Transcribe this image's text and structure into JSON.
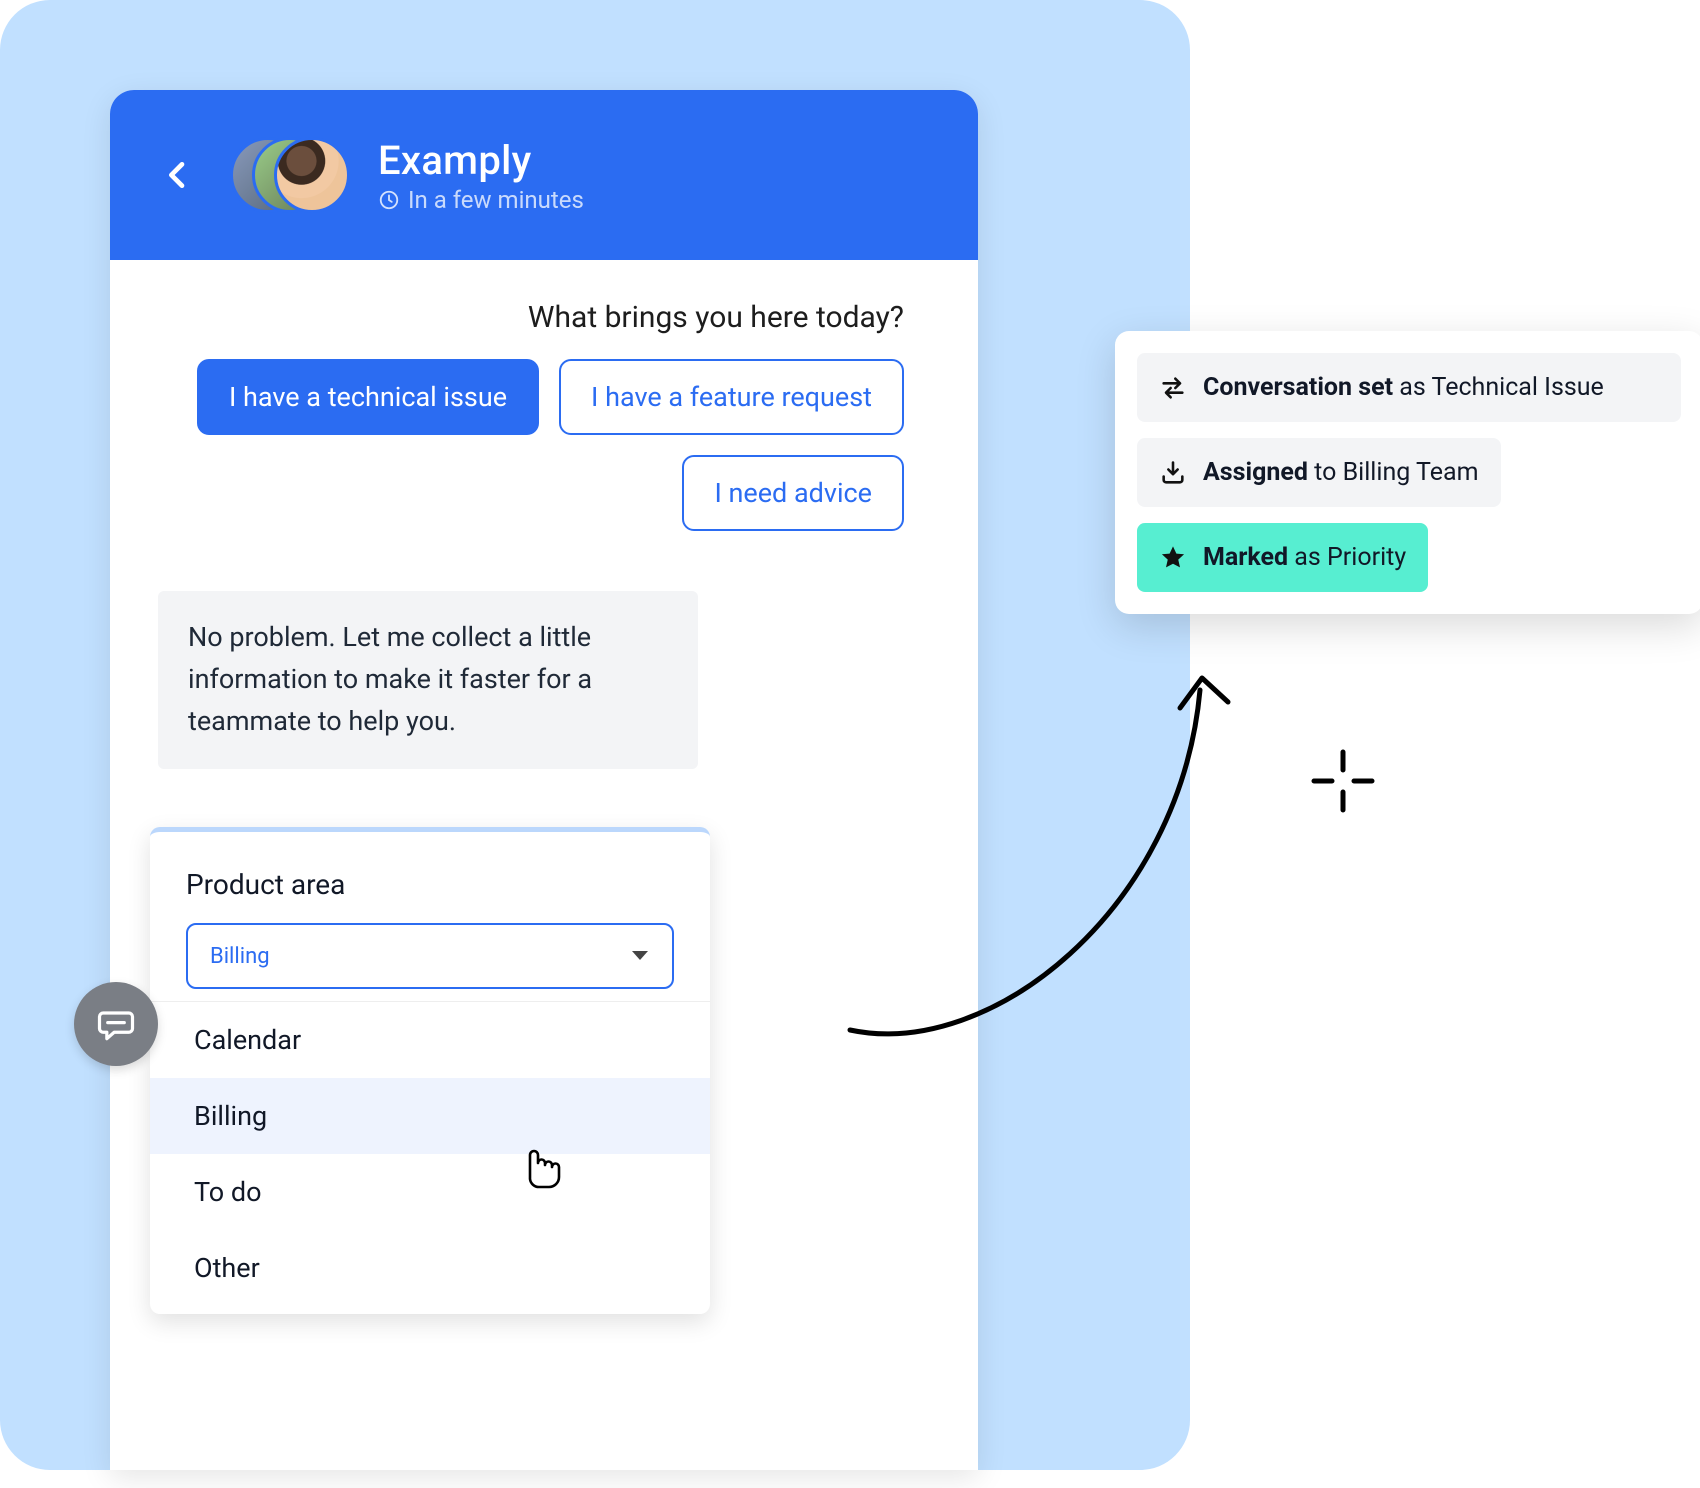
{
  "company": "Examply",
  "status_text": "In a few minutes",
  "bot_question": "What brings you here today?",
  "options": {
    "selected": "I have a technical issue",
    "other": [
      "I have a feature request",
      "I need advice"
    ]
  },
  "bot_followup": "No problem. Let me collect a little information to make it faster for a teammate to help you.",
  "dropdown": {
    "label": "Product area",
    "selected": "Billing",
    "items": [
      "Calendar",
      "Billing",
      "To do",
      "Other"
    ],
    "hover_index": 1
  },
  "status_panel": [
    {
      "icon": "swap",
      "bold": "Conversation set",
      "rest": " as Technical Issue",
      "style": "grey"
    },
    {
      "icon": "download",
      "bold": "Assigned",
      "rest": " to Billing Team",
      "style": "grey"
    },
    {
      "icon": "star",
      "bold": "Marked",
      "rest": " as Priority",
      "style": "teal"
    }
  ]
}
